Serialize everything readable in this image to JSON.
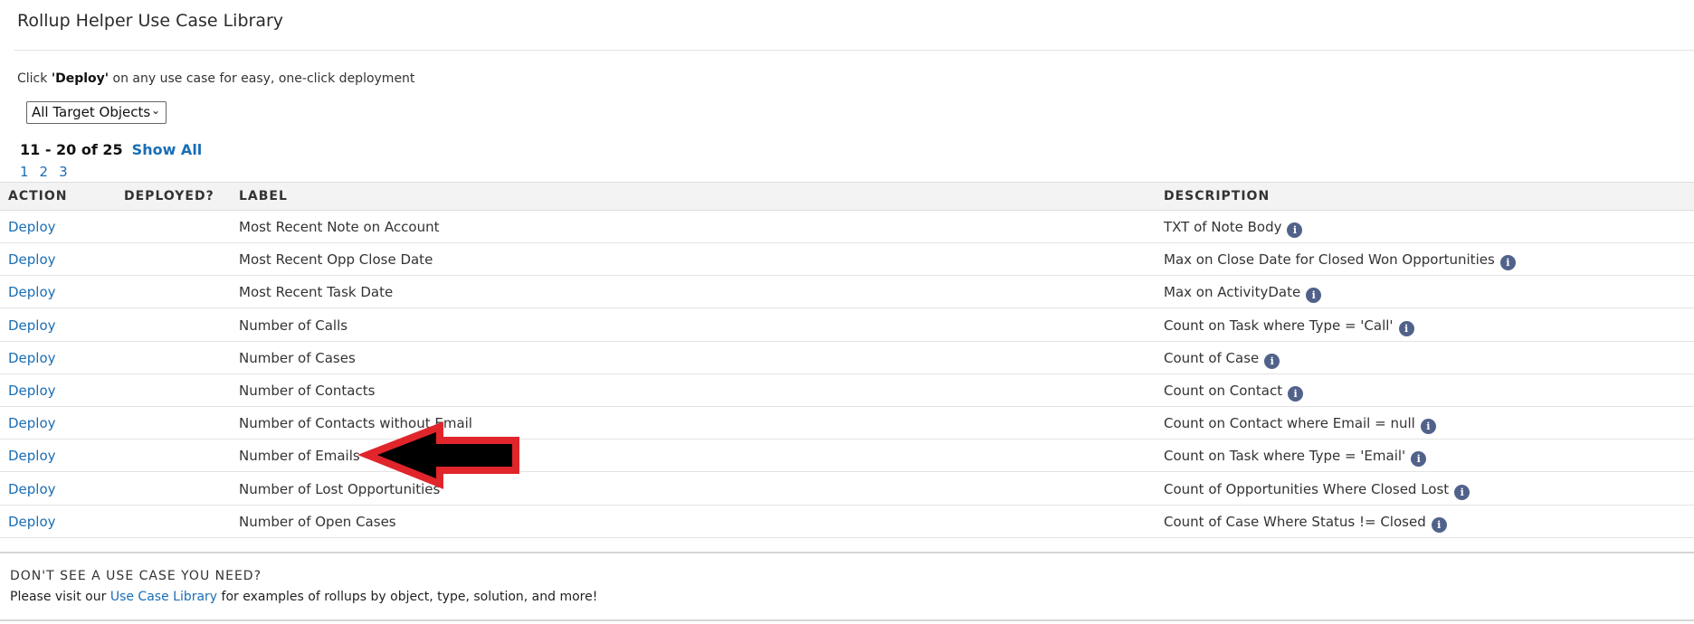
{
  "header": {
    "title": "Rollup Helper Use Case Library"
  },
  "instructions": {
    "prefix": "Click ",
    "bold": "'Deploy'",
    "suffix": " on any use case for easy, one-click deployment"
  },
  "filter": {
    "selected": "All Target Objects"
  },
  "pagination": {
    "range": "11 - 20 of 25",
    "show_all": "Show All",
    "pages": [
      "1",
      "2",
      "3"
    ]
  },
  "table": {
    "columns": [
      "ACTION",
      "DEPLOYED?",
      "LABEL",
      "DESCRIPTION"
    ],
    "rows": [
      {
        "action": "Deploy",
        "deployed": "",
        "label": "Most Recent Note on Account",
        "description": "TXT of Note Body"
      },
      {
        "action": "Deploy",
        "deployed": "",
        "label": "Most Recent Opp Close Date",
        "description": "Max on Close Date for Closed Won Opportunities"
      },
      {
        "action": "Deploy",
        "deployed": "",
        "label": "Most Recent Task Date",
        "description": "Max on ActivityDate"
      },
      {
        "action": "Deploy",
        "deployed": "",
        "label": "Number of Calls",
        "description": "Count on Task where Type = 'Call'"
      },
      {
        "action": "Deploy",
        "deployed": "",
        "label": "Number of Cases",
        "description": "Count of Case"
      },
      {
        "action": "Deploy",
        "deployed": "",
        "label": "Number of Contacts",
        "description": "Count on Contact"
      },
      {
        "action": "Deploy",
        "deployed": "",
        "label": "Number of Contacts without Email",
        "description": "Count on Contact where Email = null"
      },
      {
        "action": "Deploy",
        "deployed": "",
        "label": "Number of Emails",
        "description": "Count on Task where Type = 'Email'"
      },
      {
        "action": "Deploy",
        "deployed": "",
        "label": "Number of Lost Opportunities",
        "description": "Count of Opportunities Where Closed Lost"
      },
      {
        "action": "Deploy",
        "deployed": "",
        "label": "Number of Open Cases",
        "description": "Count of Case Where Status != Closed"
      }
    ],
    "info_icon": "i"
  },
  "footer": {
    "heading": "DON'T SEE A USE CASE YOU NEED?",
    "text_prefix": "Please visit our ",
    "link": "Use Case Library",
    "text_suffix": " for examples of rollups by object, type, solution, and more!"
  },
  "annotation": {
    "type": "arrow-left",
    "fill": "#000000",
    "stroke": "#e0252b",
    "points_to_row": "Number of Emails"
  }
}
